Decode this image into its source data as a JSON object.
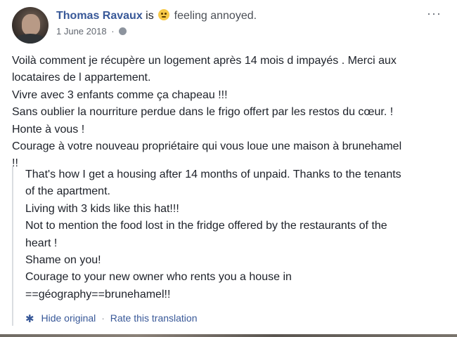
{
  "post": {
    "author": "Thomas Ravaux",
    "is_text": "is",
    "feeling": "feeling annoyed.",
    "feeling_icon": "annoyed-face-emoji",
    "date": "1 June 2018",
    "separator": "·",
    "privacy_icon": "globe-icon",
    "more_label": "···",
    "original_lines": [
      "Voilà comment je récupère un logement après 14 mois d impayés . Merci aux",
      "locataires de l appartement.",
      "Vivre avec 3 enfants comme ça chapeau !!!",
      "Sans oublier la nourriture perdue dans le frigo offert par les restos du cœur. !",
      "Honte à vous !",
      "Courage à votre nouveau propriétaire qui vous loue une maison à brunehamel",
      "!!"
    ]
  },
  "translation": {
    "lines": [
      "That's how I get a housing after 14 months of unpaid. Thanks to the tenants",
      "of the apartment.",
      "Living with 3 kids like this hat!!!",
      "Not to mention the food lost in the fridge offered by the restaurants of the",
      "heart !",
      "Shame on you!",
      "Courage to your new owner who rents you a house in",
      "==géography==brunehamel!!"
    ],
    "hide_original": "Hide original",
    "separator": "·",
    "rate": "Rate this translation",
    "gear_glyph": "✱"
  },
  "colors": {
    "link": "#385898",
    "text": "#1d2129",
    "meta": "#616770"
  }
}
